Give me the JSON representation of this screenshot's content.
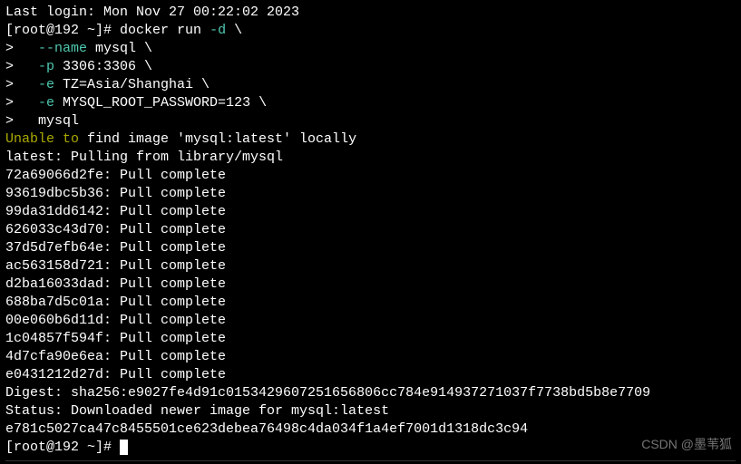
{
  "lastLogin": "Last login: Mon Nov 27 00:22:02 2023",
  "prompt1": {
    "userHost": "[root@192 ~]#",
    "cmd": " docker run ",
    "flag": "-d",
    "tail": " \\"
  },
  "cont": [
    {
      "prefix": ">   ",
      "flag": "--name",
      "rest": " mysql \\"
    },
    {
      "prefix": ">   ",
      "flag": "-p",
      "rest": " 3306:3306 \\"
    },
    {
      "prefix": ">   ",
      "flag": "-e",
      "rest": " TZ=Asia/Shanghai \\"
    },
    {
      "prefix": ">   ",
      "flag": "-e",
      "rest": " MYSQL_ROOT_PASSWORD=123 \\"
    },
    {
      "prefix": ">   mysql",
      "flag": "",
      "rest": ""
    }
  ],
  "unable": {
    "pre": "Unable to",
    "post": " find image 'mysql:latest' locally"
  },
  "pulling": "latest: Pulling from library/mysql",
  "layers": [
    "72a69066d2fe: Pull complete",
    "93619dbc5b36: Pull complete",
    "99da31dd6142: Pull complete",
    "626033c43d70: Pull complete",
    "37d5d7efb64e: Pull complete",
    "ac563158d721: Pull complete",
    "d2ba16033dad: Pull complete",
    "688ba7d5c01a: Pull complete",
    "00e060b6d11d: Pull complete",
    "1c04857f594f: Pull complete",
    "4d7cfa90e6ea: Pull complete",
    "e0431212d27d: Pull complete"
  ],
  "digest": "Digest: sha256:e9027fe4d91c0153429607251656806cc784e914937271037f7738bd5b8e7709",
  "status": "Status: Downloaded newer image for mysql:latest",
  "containerId": "e781c5027ca47c8455501ce623debea76498c4da034f1a4ef7001d1318dc3c94",
  "prompt2": "[root@192 ~]# ",
  "watermark": "CSDN @墨苇狐"
}
